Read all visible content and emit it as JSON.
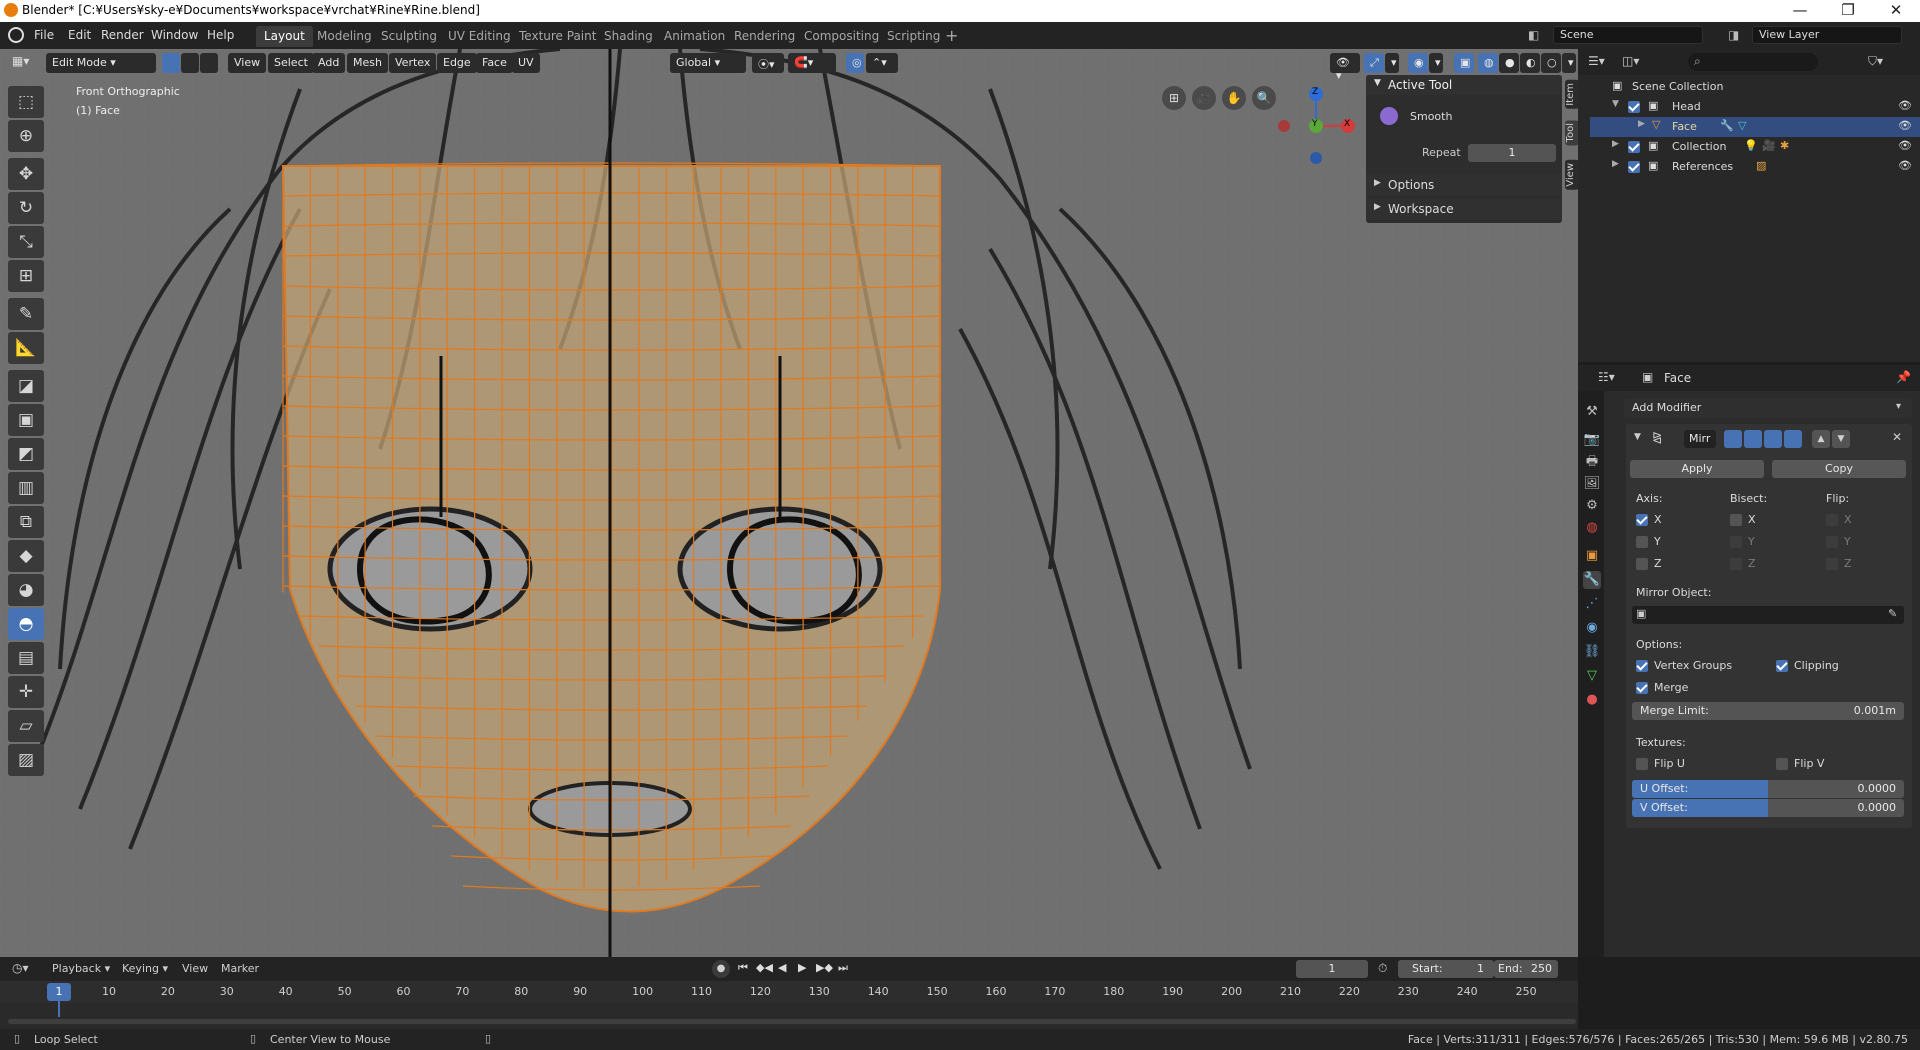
{
  "window": {
    "title": "Blender* [C:¥Users¥sky-e¥Documents¥workspace¥vrchat¥Rine¥Rine.blend]"
  },
  "menu": [
    "File",
    "Edit",
    "Render",
    "Window",
    "Help"
  ],
  "workspaces": [
    "Layout",
    "Modeling",
    "Sculpting",
    "UV Editing",
    "Texture Paint",
    "Shading",
    "Animation",
    "Rendering",
    "Compositing",
    "Scripting"
  ],
  "scene": {
    "name": "Scene",
    "view_layer": "View Layer"
  },
  "viewport": {
    "mode": "Edit Mode",
    "view": "View",
    "select": "Select",
    "add": "Add",
    "mesh": "Mesh",
    "vertex": "Vertex",
    "edge": "Edge",
    "face": "Face",
    "uv": "UV",
    "orientation": "Global",
    "view_name": "Front Orthographic",
    "object_name": "(1) Face",
    "gizmo": {
      "z": "Z",
      "y": "Y",
      "x": "X"
    }
  },
  "npanel": {
    "active_tool_title": "Active Tool",
    "tool_name": "Smooth",
    "repeat_label": "Repeat",
    "repeat_value": "1",
    "options": "Options",
    "workspace": "Workspace",
    "tabs": [
      "Item",
      "Tool",
      "View"
    ]
  },
  "outliner": {
    "root": "Scene Collection",
    "items": [
      "Head",
      "Face",
      "Collection",
      "References"
    ]
  },
  "properties": {
    "object": "Face",
    "add_modifier": "Add Modifier",
    "modifier_name": "Mirr",
    "apply": "Apply",
    "copy": "Copy",
    "axis": "Axis:",
    "bisect": "Bisect:",
    "flip": "Flip:",
    "axes": [
      "X",
      "Y",
      "Z"
    ],
    "mirror_object": "Mirror Object:",
    "options": "Options:",
    "vertex_groups": "Vertex Groups",
    "clipping": "Clipping",
    "merge": "Merge",
    "merge_limit_label": "Merge Limit:",
    "merge_limit_value": "0.001m",
    "textures": "Textures:",
    "flip_u": "Flip U",
    "flip_v": "Flip V",
    "u_offset_label": "U Offset:",
    "u_offset_value": "0.0000",
    "v_offset_label": "V Offset:",
    "v_offset_value": "0.0000"
  },
  "timeline": {
    "playback": "Playback",
    "keying": "Keying",
    "view": "View",
    "marker": "Marker",
    "current": "1",
    "start_label": "Start:",
    "start": "1",
    "end_label": "End:",
    "end": "250",
    "ticks": [
      "10",
      "20",
      "30",
      "40",
      "50",
      "60",
      "70",
      "80",
      "90",
      "100",
      "110",
      "120",
      "130",
      "140",
      "150",
      "160",
      "170",
      "180",
      "190",
      "200",
      "210",
      "220",
      "230",
      "240",
      "250"
    ]
  },
  "status": {
    "left1": "Loop Select",
    "left2": "Center View to Mouse",
    "stats": "Face | Verts:311/311 | Edges:576/576 | Faces:265/265 | Tris:530 | Mem: 59.6 MB | v2.80.75"
  },
  "colors": {
    "accent": "#4772b3",
    "mesh": "#e07a20",
    "mesh_fill": "#c8a878"
  }
}
